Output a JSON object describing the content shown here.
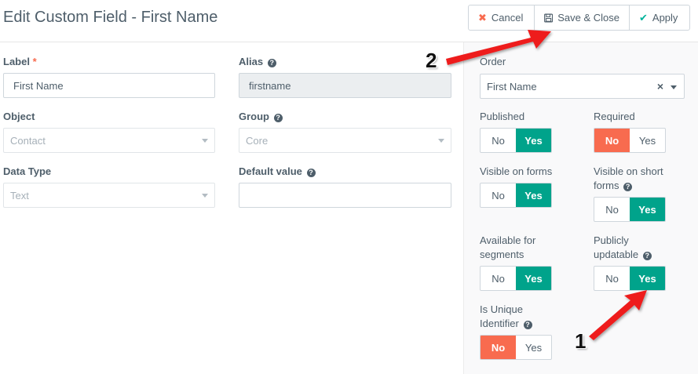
{
  "header": {
    "title": "Edit Custom Field - First Name",
    "buttons": {
      "cancel": "Cancel",
      "save_close": "Save & Close",
      "apply": "Apply"
    }
  },
  "form": {
    "label": {
      "label": "Label",
      "required_mark": "*",
      "value": "First Name"
    },
    "alias": {
      "label": "Alias",
      "value": "firstname"
    },
    "object": {
      "label": "Object",
      "value": "Contact"
    },
    "group": {
      "label": "Group",
      "value": "Core"
    },
    "data_type": {
      "label": "Data Type",
      "value": "Text"
    },
    "default_value": {
      "label": "Default value",
      "value": ""
    }
  },
  "sidebar": {
    "order": {
      "label": "Order",
      "value": "First Name",
      "clear": "×"
    },
    "toggles": {
      "published": {
        "label": "Published",
        "no": "No",
        "yes": "Yes",
        "selected": "yes"
      },
      "required": {
        "label": "Required",
        "no": "No",
        "yes": "Yes",
        "selected": "no"
      },
      "visible_forms": {
        "label": "Visible on forms",
        "no": "No",
        "yes": "Yes",
        "selected": "yes"
      },
      "visible_short_forms": {
        "label_line1": "Visible on short",
        "label_line2": "forms",
        "no": "No",
        "yes": "Yes",
        "selected": "yes"
      },
      "available_segments": {
        "label_line1": "Available for",
        "label_line2": "segments",
        "no": "No",
        "yes": "Yes",
        "selected": "yes"
      },
      "publicly_updatable": {
        "label_line1": "Publicly",
        "label_line2": "updatable",
        "no": "No",
        "yes": "Yes",
        "selected": "yes"
      },
      "unique_identifier": {
        "label_line1": "Is Unique",
        "label_line2": "Identifier",
        "no": "No",
        "yes": "Yes",
        "selected": "no"
      }
    }
  },
  "annotations": {
    "marker_1": "1",
    "marker_2": "2",
    "arrow_color": "#ee1c1c"
  },
  "colors": {
    "accent_yes": "#00a38b",
    "accent_no": "#f86b4f",
    "text": "#4e5e6a"
  }
}
